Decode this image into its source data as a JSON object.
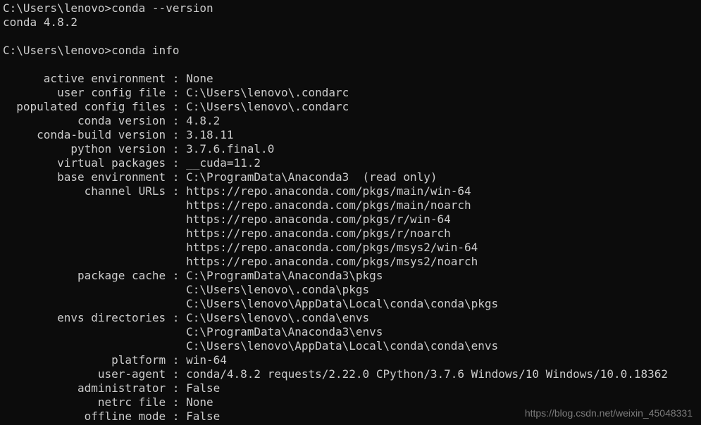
{
  "prompt1": "C:\\Users\\lenovo>",
  "cmd1": "conda --version",
  "out1": "conda 4.8.2",
  "prompt2": "C:\\Users\\lenovo>",
  "cmd2": "conda info",
  "separator": " : ",
  "info": [
    {
      "label": "active environment",
      "values": [
        "None"
      ]
    },
    {
      "label": "user config file",
      "values": [
        "C:\\Users\\lenovo\\.condarc"
      ]
    },
    {
      "label": "populated config files",
      "values": [
        "C:\\Users\\lenovo\\.condarc"
      ]
    },
    {
      "label": "conda version",
      "values": [
        "4.8.2"
      ]
    },
    {
      "label": "conda-build version",
      "values": [
        "3.18.11"
      ]
    },
    {
      "label": "python version",
      "values": [
        "3.7.6.final.0"
      ]
    },
    {
      "label": "virtual packages",
      "values": [
        "__cuda=11.2"
      ]
    },
    {
      "label": "base environment",
      "values": [
        "C:\\ProgramData\\Anaconda3  (read only)"
      ]
    },
    {
      "label": "channel URLs",
      "values": [
        "https://repo.anaconda.com/pkgs/main/win-64",
        "https://repo.anaconda.com/pkgs/main/noarch",
        "https://repo.anaconda.com/pkgs/r/win-64",
        "https://repo.anaconda.com/pkgs/r/noarch",
        "https://repo.anaconda.com/pkgs/msys2/win-64",
        "https://repo.anaconda.com/pkgs/msys2/noarch"
      ]
    },
    {
      "label": "package cache",
      "values": [
        "C:\\ProgramData\\Anaconda3\\pkgs",
        "C:\\Users\\lenovo\\.conda\\pkgs",
        "C:\\Users\\lenovo\\AppData\\Local\\conda\\conda\\pkgs"
      ]
    },
    {
      "label": "envs directories",
      "values": [
        "C:\\Users\\lenovo\\.conda\\envs",
        "C:\\ProgramData\\Anaconda3\\envs",
        "C:\\Users\\lenovo\\AppData\\Local\\conda\\conda\\envs"
      ]
    },
    {
      "label": "platform",
      "values": [
        "win-64"
      ]
    },
    {
      "label": "user-agent",
      "values": [
        "conda/4.8.2 requests/2.22.0 CPython/3.7.6 Windows/10 Windows/10.0.18362"
      ]
    },
    {
      "label": "administrator",
      "values": [
        "False"
      ]
    },
    {
      "label": "netrc file",
      "values": [
        "None"
      ]
    },
    {
      "label": "offline mode",
      "values": [
        "False"
      ]
    }
  ],
  "watermark": "https://blog.csdn.net/weixin_45048331"
}
